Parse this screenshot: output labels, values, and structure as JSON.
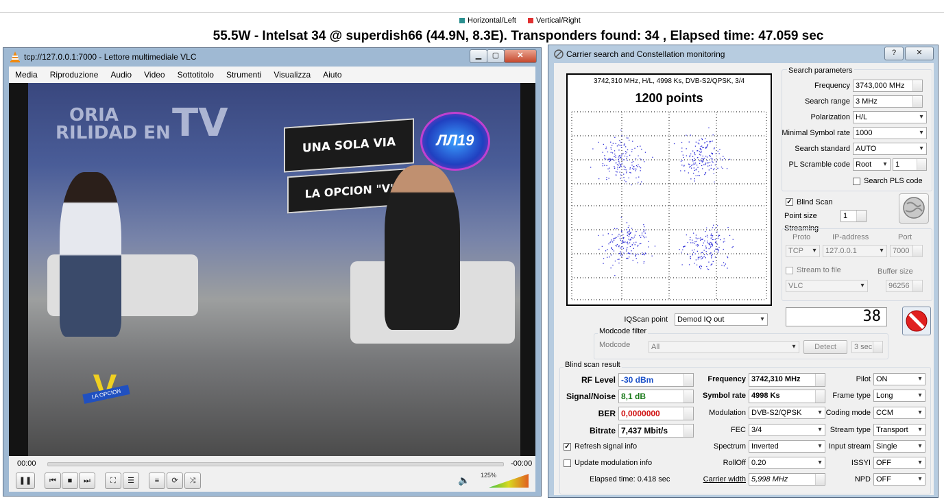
{
  "header": {
    "legend": [
      {
        "label": "Horizontal/Left",
        "color": "#2a8f8f"
      },
      {
        "label": "Vertical/Right",
        "color": "#e03030"
      }
    ],
    "title": "55.5W - Intelsat 34 @ superdish66 (44.9N, 8.3E). Transponders found: 34 , Elapsed time: 47.059 sec"
  },
  "vlc": {
    "title": "tcp://127.0.0.1:7000 - Lettore multimediale VLC",
    "menu": [
      "Media",
      "Riproduzione",
      "Audio",
      "Video",
      "Sottotitolo",
      "Strumenti",
      "Visualizza",
      "Aiuto"
    ],
    "video": {
      "sign_top": "UNA SOLA VIA",
      "sign_bottom": "LA OPCION \"V\"",
      "backdrop_left": "ORIA",
      "backdrop_left2": "RILIDAD EN",
      "backdrop_tv": "TV",
      "logo_text": "ЛЛ19",
      "badge_letter": "V",
      "badge_text": "LA OPCION"
    },
    "time_elapsed": "00:00",
    "time_remaining": "-00:00",
    "volume": "125%",
    "volume_level": 1.25
  },
  "cs": {
    "title": "Carrier search and Constellation monitoring",
    "help_label": "?",
    "constellation": {
      "info": "3742,310 MHz, H/L, 4998 Ks, DVB-S2/QPSK, 3/4",
      "points_label": "1200 points",
      "point_color": "#2c2cd8"
    },
    "search": {
      "group_title": "Search parameters",
      "frequency_label": "Frequency",
      "frequency": "3743,000 MHz",
      "range_label": "Search range",
      "range": "3 MHz",
      "polarization_label": "Polarization",
      "polarization": "H/L",
      "min_sr_label": "Minimal Symbol rate",
      "min_sr": "1000",
      "standard_label": "Search standard",
      "standard": "AUTO",
      "pls_label": "PL Scramble code",
      "pls_mode": "Root",
      "pls_value": "1",
      "search_pls_label": "Search PLS code"
    },
    "blind_scan_label": "Blind Scan",
    "point_size_label": "Point size",
    "point_size": "1",
    "streaming": {
      "title": "Streaming",
      "proto_label": "Proto",
      "ip_label": "IP-address",
      "port_label": "Port",
      "proto": "TCP",
      "ip": "127.0.0.1",
      "port": "7000",
      "stream_file_label": "Stream to file",
      "buffer_label": "Buffer size",
      "player": "VLC",
      "buffer": "96256"
    },
    "iqscan_label": "IQScan point",
    "iqscan": "Demod IQ out",
    "counter": "38",
    "modcode": {
      "group_title": "Modcode filter",
      "label": "Modcode",
      "value": "All",
      "detect_label": "Detect",
      "time": "3 sec"
    },
    "result": {
      "group_title": "Blind scan result",
      "rf_label": "RF Level",
      "rf": "-30 dBm",
      "rf_color": "#1a50c8",
      "sn_label": "Signal/Noise",
      "sn": "8,1 dB",
      "sn_color": "#1a7a1a",
      "ber_label": "BER",
      "ber": "0,0000000",
      "ber_color": "#d01010",
      "bitrate_label": "Bitrate",
      "bitrate": "7,437 Mbit/s",
      "freq_label": "Frequency",
      "freq": "3742,310 MHz",
      "sr_label": "Symbol rate",
      "sr": "4998 Ks",
      "mod_label": "Modulation",
      "mod": "DVB-S2/QPSK",
      "fec_label": "FEC",
      "fec": "3/4",
      "spectrum_label": "Spectrum",
      "spectrum": "Inverted",
      "rolloff_label": "RollOff",
      "rolloff": "0.20",
      "carrier_label": "Carrier width",
      "carrier": "5,998 MHz",
      "pilot_label": "Pilot",
      "pilot": "ON",
      "frame_label": "Frame type",
      "frame": "Long",
      "coding_label": "Coding mode",
      "coding": "CCM",
      "stype_label": "Stream type",
      "stype": "Transport",
      "istream_label": "Input stream",
      "istream": "Single",
      "issyi_label": "ISSYI",
      "issyi": "OFF",
      "npd_label": "NPD",
      "npd": "OFF",
      "refresh_label": "Refresh signal info",
      "update_label": "Update modulation info",
      "elapsed": "Elapsed time: 0.418 sec"
    }
  }
}
